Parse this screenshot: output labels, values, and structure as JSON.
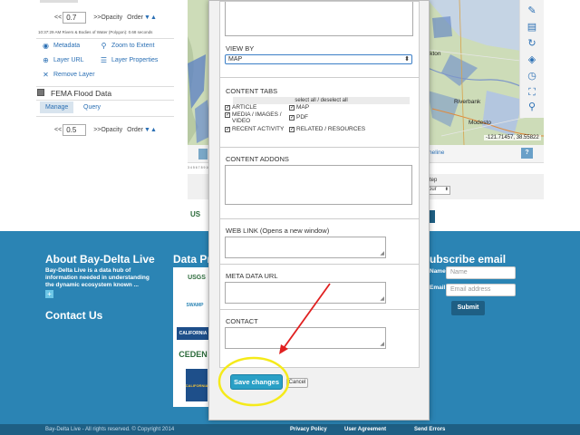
{
  "left_panel": {
    "layer1": {
      "opacity_value": "0.7",
      "prev_label": "<<",
      "opacity_label": ">>Opacity",
      "order_label": "Order",
      "timestamp": "10:37:29 AM Rivers & Bodies of Water (Polygon): 0.68 seconds",
      "links": [
        "Metadata",
        "Zoom to Extent",
        "Layer URL",
        "Layer Properties",
        "Remove Layer"
      ]
    },
    "layer2": {
      "title": "FEMA Flood Data",
      "tabs": [
        "Manage",
        "Query"
      ],
      "opacity_value": "0.5",
      "prev_label": "<<",
      "opacity_label": ">>Opacity",
      "order_label": "Order"
    }
  },
  "map": {
    "place_labels": [
      "skton",
      "Riverbank",
      "Modesto"
    ],
    "coordinates": "-121.71457, 38.55822",
    "timeline_label": "neline",
    "help_label": "?",
    "step_label": "tep",
    "step_value": "our",
    "timeline_ticks": "3  4  5  6  7  8  9  10 11 12 13 14 15 16 17 18 19 20 21 22 23 24 25 26 27 28 29 30 31  1  2  3  4  5  6  7  8  9  10 11 12 13 14 15 16",
    "usgs_text": "US"
  },
  "modal": {
    "view_by": {
      "label": "VIEW BY",
      "value": "MAP"
    },
    "content_tabs": {
      "label": "CONTENT TABS",
      "select_all": "select all / deselect all",
      "items": [
        "ARTICLE",
        "MAP",
        "MEDIA / IMAGES / VIDEO",
        "PDF",
        "RECENT ACTIVITY",
        "RELATED / RESOURCES"
      ]
    },
    "content_addons": {
      "label": "CONTENT ADDONS"
    },
    "web_link": {
      "label": "WEB LINK (Opens a new window)"
    },
    "meta_data_url": {
      "label": "META DATA URL"
    },
    "contact": {
      "label": "CONTACT"
    },
    "save_label": "Save changes",
    "cancel_label": "Cancel"
  },
  "footer": {
    "about_title": "About Bay-Delta Live",
    "about_text": "Bay-Delta Live is a data hub of information needed in understanding the dynamic ecosystem known ...",
    "more_label": "+",
    "contact_title": "Contact Us",
    "partners_title": "Data Pr",
    "partner_logos": [
      "USGS",
      "SWAMP",
      "CALIFORNIA",
      "CEDEN",
      "CALIFORNIA"
    ],
    "subscribe_title": "ubscribe email",
    "name_label": "Name",
    "name_placeholder": "Name",
    "email_label": "Email",
    "email_placeholder": "Email address",
    "submit_label": "Submit",
    "copyright": "Bay-Delta Live - All rights reserved. © Copyright 2014",
    "links": [
      "Privacy Policy",
      "User Agreement",
      "Send Errors"
    ]
  },
  "colors": {
    "accent": "#2a6fb4",
    "footer_bg": "#2b84b4",
    "footer_bottom": "#1e5f84",
    "save_button": "#2aa0c6",
    "annotation_red": "#e02020",
    "annotation_yellow": "#f5ea1a"
  }
}
